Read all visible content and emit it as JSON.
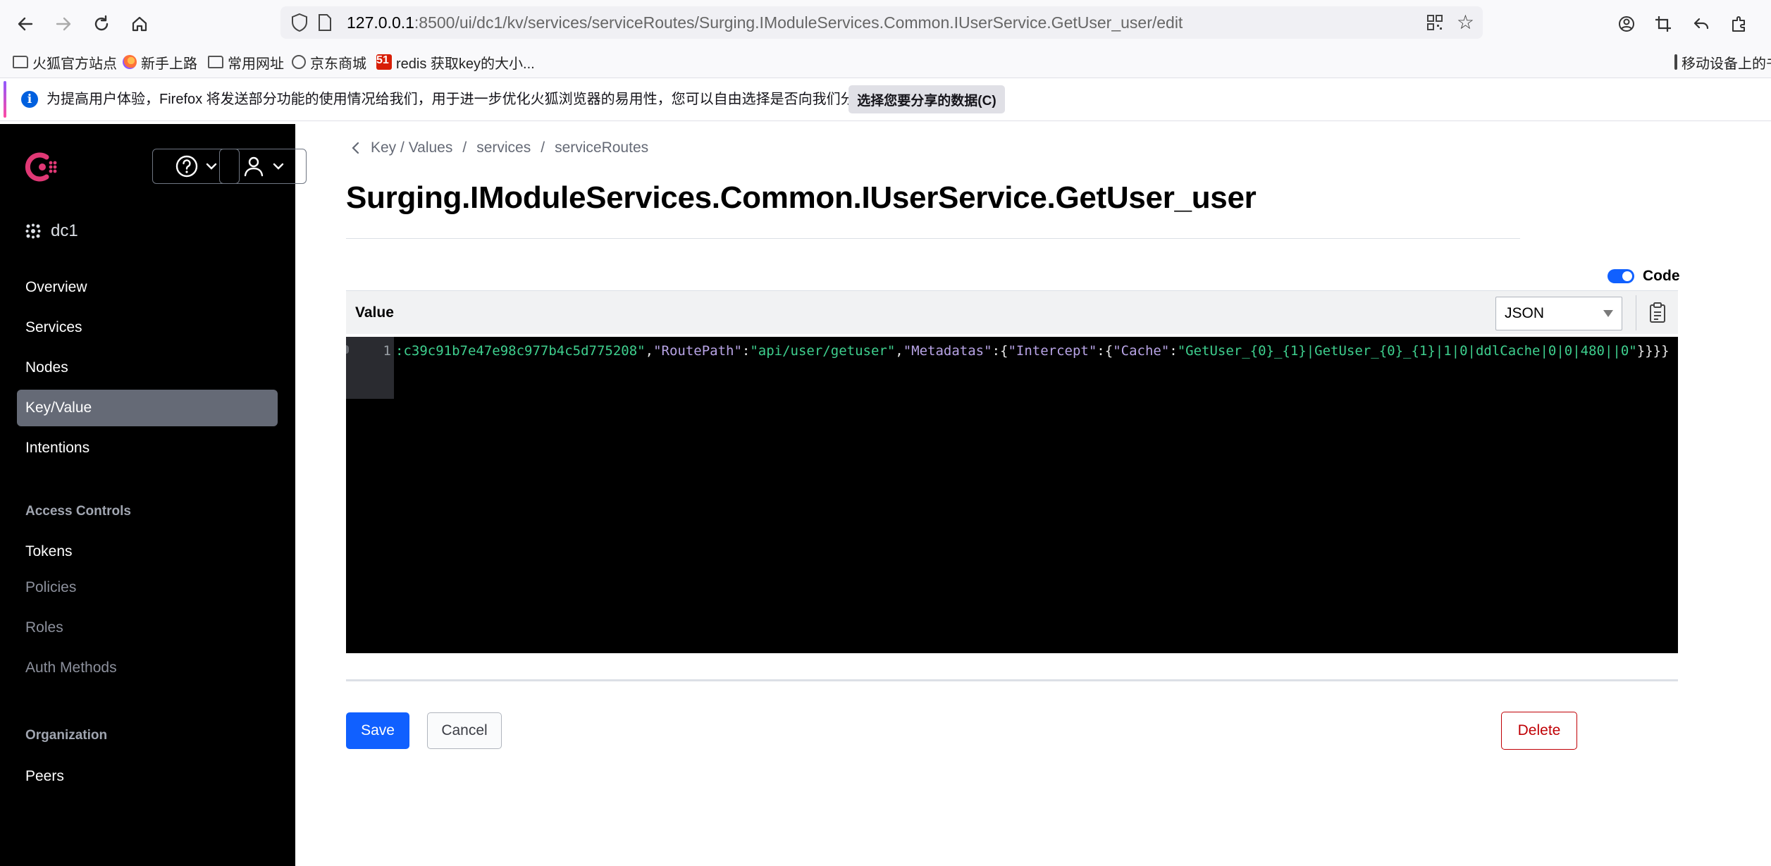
{
  "browser": {
    "url_host": "127.0.0.1",
    "url_rest": ":8500/ui/dc1/kv/services/serviceRoutes/Surging.IModuleServices.Common.IUserService.GetUser_user/edit",
    "bookmarks": [
      {
        "label": "火狐官方站点",
        "icon": "folder-icon"
      },
      {
        "label": "新手上路",
        "icon": "firefox-icon"
      },
      {
        "label": "常用网址",
        "icon": "folder-icon"
      },
      {
        "label": "京东商城",
        "icon": "globe-icon"
      },
      {
        "label": "redis 获取key的大小...",
        "icon": "cto-icon"
      }
    ],
    "cto_glyph": "51",
    "mobile_bookmarks": "移动设备上的书签",
    "notification": {
      "message": "为提高用户体验，Firefox 将发送部分功能的使用情况给我们，用于进一步优化火狐浏览器的易用性，您可以自由选择是否向我们分享数据。",
      "button": "选择您要分享的数据(C)"
    }
  },
  "sidebar": {
    "datacenter": "dc1",
    "nav": [
      "Overview",
      "Services",
      "Nodes",
      "Key/Value",
      "Intentions"
    ],
    "active": "Key/Value",
    "access_controls_heading": "Access Controls",
    "access_controls": [
      "Tokens",
      "Policies",
      "Roles",
      "Auth Methods"
    ],
    "organization_heading": "Organization",
    "organization": [
      "Peers"
    ]
  },
  "main": {
    "breadcrumb": [
      "Key / Values",
      "services",
      "serviceRoutes"
    ],
    "title": "Surging.IModuleServices.Common.IUserService.GetUser_user",
    "code_toggle_label": "Code",
    "value_label": "Value",
    "format_select": "JSON",
    "line_number": "1",
    "code_tokens": [
      {
        "t": ":c39c91b7e47e98c977b4c5d775208\"",
        "c": "str"
      },
      {
        "t": ",",
        "c": "punc"
      },
      {
        "t": "\"RoutePath\"",
        "c": "key"
      },
      {
        "t": ":",
        "c": "punc"
      },
      {
        "t": "\"api/user/getuser\"",
        "c": "str"
      },
      {
        "t": ",",
        "c": "punc"
      },
      {
        "t": "\"Metadatas\"",
        "c": "key"
      },
      {
        "t": ":{",
        "c": "punc"
      },
      {
        "t": "\"Intercept\"",
        "c": "key"
      },
      {
        "t": ":{",
        "c": "punc"
      },
      {
        "t": "\"Cache\"",
        "c": "key"
      },
      {
        "t": ":",
        "c": "punc"
      },
      {
        "t": "\"GetUser_{0}_{1}|GetUser_{0}_{1}|1|0|ddlCache|0|0|480||0\"",
        "c": "str"
      },
      {
        "t": "}}}}",
        "c": "punc"
      }
    ],
    "buttons": {
      "save": "Save",
      "cancel": "Cancel",
      "delete": "Delete"
    }
  },
  "colors": {
    "accent": "#1060ff",
    "danger": "#c00005",
    "sidebar_bg": "#000000",
    "consul_brand": "#e03875"
  }
}
